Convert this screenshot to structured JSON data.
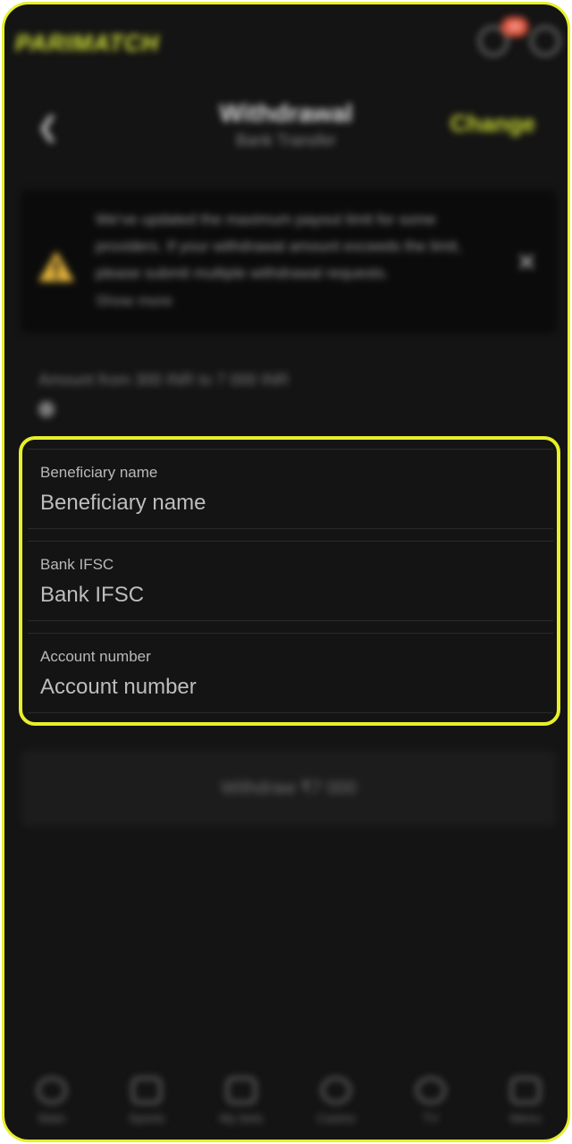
{
  "app": {
    "logo_text": "PARIMATCH",
    "notification_count": "99"
  },
  "header": {
    "title": "Withdrawal",
    "subtitle": "Bank Transfer",
    "change_label": "Change"
  },
  "notice": {
    "text": "We've updated the maximum payout limit for some providers. If your withdrawal amount exceeds the limit, please submit multiple withdrawal requests.",
    "show_more_label": "Show more"
  },
  "amount": {
    "label": "Amount from 300 INR to 7 000 INR"
  },
  "form": {
    "beneficiary": {
      "label": "Beneficiary name",
      "placeholder": "Beneficiary name",
      "value": ""
    },
    "ifsc": {
      "label": "Bank IFSC",
      "placeholder": "Bank IFSC",
      "value": ""
    },
    "account": {
      "label": "Account number",
      "placeholder": "Account number",
      "value": ""
    }
  },
  "withdraw_button": {
    "label": "Withdraw ₹7 000"
  },
  "bottom_nav": [
    {
      "label": "Main",
      "icon": "home-icon"
    },
    {
      "label": "Sports",
      "icon": "sports-icon"
    },
    {
      "label": "My bets",
      "icon": "bets-icon"
    },
    {
      "label": "Casino",
      "icon": "casino-icon"
    },
    {
      "label": "TV",
      "icon": "tv-icon"
    },
    {
      "label": "Menu",
      "icon": "menu-icon"
    }
  ],
  "colors": {
    "accent": "#e8ef2a",
    "background": "#141414",
    "warning": "#e0b13a"
  }
}
